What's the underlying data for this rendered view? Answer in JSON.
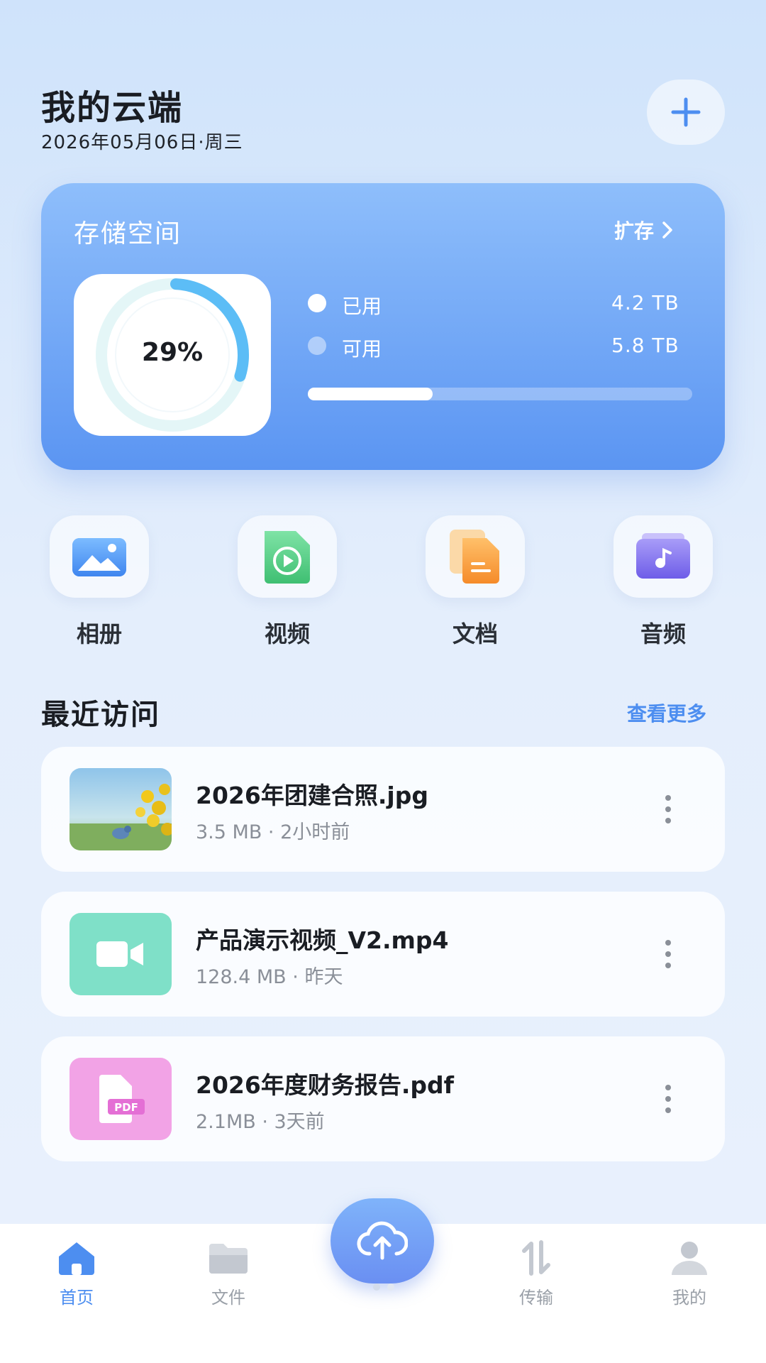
{
  "header": {
    "title": "我的云端",
    "date": "2026年05月06日·周三",
    "add_icon": "plus-icon"
  },
  "storage": {
    "title": "存储空间",
    "expand_label": "扩存",
    "percent_label": "29%",
    "used_fraction": 0.29,
    "used_label": "已用",
    "used_value": "4.2 TB",
    "free_label": "可用",
    "free_value": "5.8 TB",
    "accent": "#5b95f2"
  },
  "categories": [
    {
      "label": "相册",
      "icon": "photo-icon",
      "color": "#5aa2f5"
    },
    {
      "label": "视频",
      "icon": "video-file-icon",
      "color": "#5fd08e"
    },
    {
      "label": "文档",
      "icon": "document-icon",
      "color": "#f8a23d"
    },
    {
      "label": "音频",
      "icon": "music-icon",
      "color": "#8a7cf0"
    }
  ],
  "recent": {
    "title": "最近访问",
    "more_label": "查看更多",
    "files": [
      {
        "name": "2026年团建合照.jpg",
        "meta": "3.5 MB · 2小时前",
        "icon": "image-thumbnail",
        "color": "#cfe6f5"
      },
      {
        "name": "产品演示视频_V2.mp4",
        "meta": "128.4 MB · 昨天",
        "icon": "video-camera-icon",
        "color": "#7fe0c8"
      },
      {
        "name": "2026年度财务报告.pdf",
        "meta": "2.1MB · 3天前",
        "icon": "pdf-icon",
        "color": "#f2a3e6"
      }
    ]
  },
  "nav": {
    "items": [
      {
        "label": "首页",
        "icon": "home-icon",
        "active": true
      },
      {
        "label": "文件",
        "icon": "folder-icon",
        "active": false
      },
      {
        "label": "传输",
        "icon": "transfer-icon",
        "active": false
      },
      {
        "label": "我的",
        "icon": "user-icon",
        "active": false
      }
    ],
    "upload_icon": "cloud-upload-icon"
  }
}
